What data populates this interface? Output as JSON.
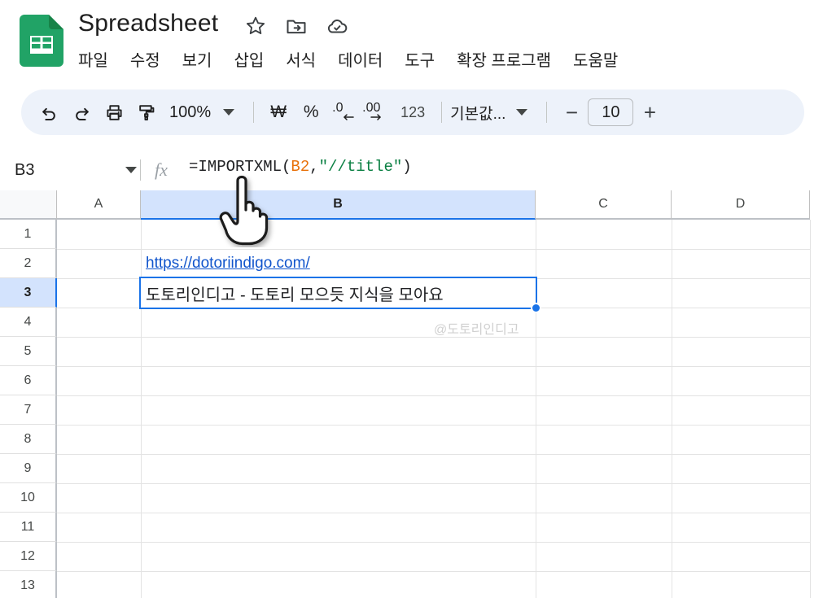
{
  "app": {
    "title": "Spreadsheet",
    "logo_icon": "google-sheets-logo-icon",
    "title_icons": [
      {
        "name": "star-icon",
        "label": "별표"
      },
      {
        "name": "move-to-folder-icon",
        "label": "폴더로 이동"
      },
      {
        "name": "cloud-saved-icon",
        "label": "Drive에 저장됨"
      }
    ]
  },
  "menubar": {
    "items": [
      {
        "label": "파일"
      },
      {
        "label": "수정"
      },
      {
        "label": "보기"
      },
      {
        "label": "삽입"
      },
      {
        "label": "서식"
      },
      {
        "label": "데이터"
      },
      {
        "label": "도구"
      },
      {
        "label": "확장 프로그램"
      },
      {
        "label": "도움말"
      }
    ]
  },
  "toolbar": {
    "undo_icon": "undo-icon",
    "redo_icon": "redo-icon",
    "print_icon": "print-icon",
    "paint_format_icon": "paint-format-icon",
    "zoom_value": "100%",
    "zoom_caret_icon": "chevron-down-icon",
    "currency_label": "₩",
    "percent_label": "%",
    "decrease_decimal_label": ".0",
    "increase_decimal_label": ".00",
    "number_format_label": "123",
    "font_name": "기본값...",
    "font_caret_icon": "chevron-down-icon",
    "font_decrease_label": "−",
    "font_size": "10",
    "font_increase_label": "+"
  },
  "formula_bar": {
    "name_box_value": "B3",
    "name_box_caret_icon": "chevron-down-icon",
    "fx_label": "fx",
    "formula_prefix": "=IMPORTXML(",
    "formula_ref": "B2",
    "formula_comma": ",",
    "formula_string": "\"//title\"",
    "formula_suffix": ")",
    "formula_full": "=IMPORTXML(B2,\"//title\")"
  },
  "grid": {
    "columns": [
      {
        "label": "A",
        "selected": false
      },
      {
        "label": "B",
        "selected": true
      },
      {
        "label": "C",
        "selected": false
      },
      {
        "label": "D",
        "selected": false
      }
    ],
    "rows": [
      {
        "label": "1",
        "selected": false
      },
      {
        "label": "2",
        "selected": false
      },
      {
        "label": "3",
        "selected": true
      },
      {
        "label": "4",
        "selected": false
      },
      {
        "label": "5",
        "selected": false
      },
      {
        "label": "6",
        "selected": false
      },
      {
        "label": "7",
        "selected": false
      },
      {
        "label": "8",
        "selected": false
      },
      {
        "label": "9",
        "selected": false
      },
      {
        "label": "10",
        "selected": false
      },
      {
        "label": "11",
        "selected": false
      },
      {
        "label": "12",
        "selected": false
      },
      {
        "label": "13",
        "selected": false
      }
    ],
    "cells": {
      "b2_link": "https://dotoriindigo.com/",
      "b3_value": "도토리인디고 - 도토리 모으듯 지식을 모아요"
    },
    "selected_cell": "B3",
    "watermark": "@도토리인디고"
  },
  "cursor": {
    "icon": "pointing-hand-cursor-icon"
  },
  "colors": {
    "brand_green": "#21a366",
    "accent_blue": "#1a73e8",
    "selection_fill": "#d3e3fd",
    "toolbar_bg": "#edf2fa",
    "link_blue": "#1155cc",
    "formula_ref": "#e8710a",
    "formula_string": "#0b8043"
  }
}
